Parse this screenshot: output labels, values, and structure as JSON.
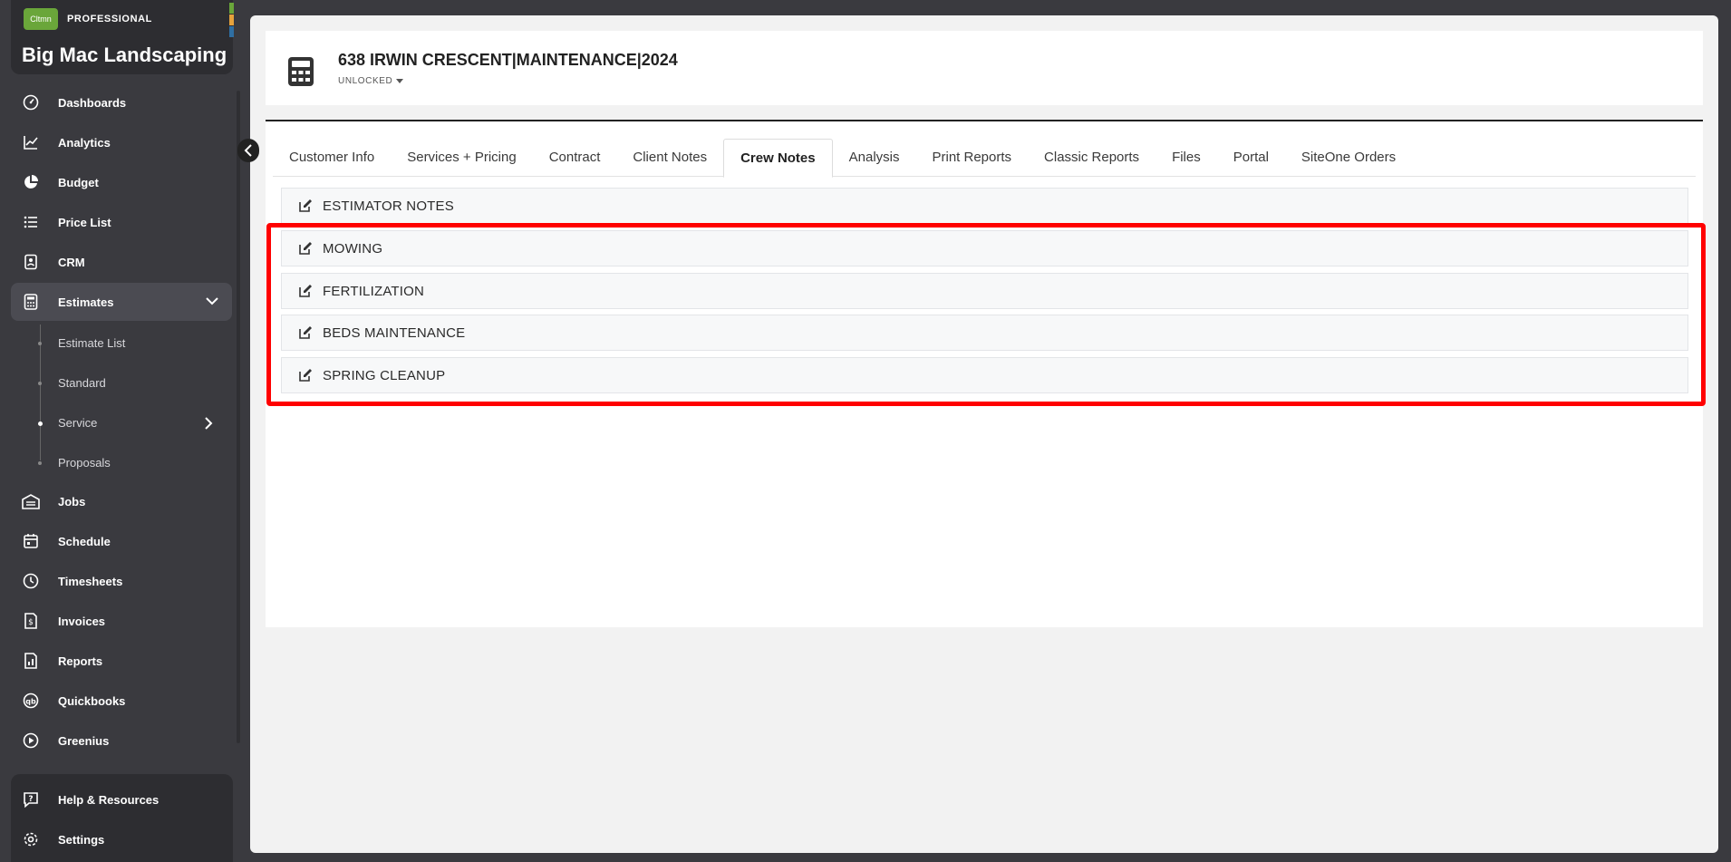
{
  "brand": {
    "logo_text": "Cltmn",
    "tier": "PROFESSIONAL",
    "company": "Big Mac Landscaping",
    "stripe_colors": [
      "#6aa63a",
      "#e6a23c",
      "#2f6fa3"
    ]
  },
  "sidebar": {
    "items": [
      {
        "label": "Dashboards",
        "icon": "dashboard-gauge-icon"
      },
      {
        "label": "Analytics",
        "icon": "line-chart-icon"
      },
      {
        "label": "Budget",
        "icon": "pie-chart-icon"
      },
      {
        "label": "Price List",
        "icon": "list-icon"
      },
      {
        "label": "CRM",
        "icon": "contact-card-icon"
      },
      {
        "label": "Estimates",
        "icon": "calculator-icon"
      },
      {
        "label": "Jobs",
        "icon": "warehouse-icon"
      },
      {
        "label": "Schedule",
        "icon": "calendar-icon"
      },
      {
        "label": "Timesheets",
        "icon": "clock-icon"
      },
      {
        "label": "Invoices",
        "icon": "invoice-icon"
      },
      {
        "label": "Reports",
        "icon": "report-icon"
      },
      {
        "label": "Quickbooks",
        "icon": "quickbooks-icon"
      },
      {
        "label": "Greenius",
        "icon": "play-circle-icon"
      }
    ],
    "estimates_sub": [
      {
        "label": "Estimate List"
      },
      {
        "label": "Standard"
      },
      {
        "label": "Service"
      },
      {
        "label": "Proposals"
      }
    ],
    "bottom": [
      {
        "label": "Help & Resources",
        "icon": "help-icon"
      },
      {
        "label": "Settings",
        "icon": "gear-icon"
      }
    ]
  },
  "header": {
    "title": "638 IRWIN CRESCENT|MAINTENANCE|2024",
    "status": "UNLOCKED"
  },
  "tabs": [
    {
      "label": "Customer Info"
    },
    {
      "label": "Services + Pricing"
    },
    {
      "label": "Contract"
    },
    {
      "label": "Client Notes"
    },
    {
      "label": "Crew Notes",
      "active": true
    },
    {
      "label": "Analysis"
    },
    {
      "label": "Print Reports"
    },
    {
      "label": "Classic Reports"
    },
    {
      "label": "Files"
    },
    {
      "label": "Portal"
    },
    {
      "label": "SiteOne Orders"
    }
  ],
  "notes": [
    {
      "label": "ESTIMATOR NOTES"
    },
    {
      "label": "MOWING"
    },
    {
      "label": "FERTILIZATION"
    },
    {
      "label": "BEDS MAINTENANCE"
    },
    {
      "label": "SPRING CLEANUP"
    }
  ],
  "colors": {
    "highlight": "#ff0000",
    "sidebar_bg": "#3a3a3f",
    "brand_green": "#6aa63a"
  }
}
